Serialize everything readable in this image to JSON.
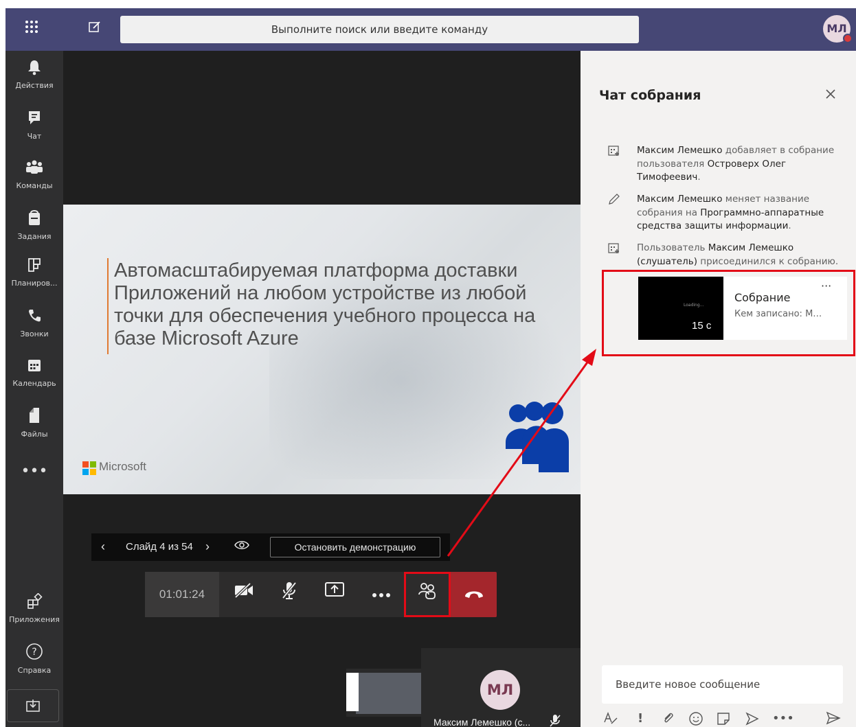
{
  "topbar": {
    "apps_icon": "grid-icon",
    "compose_icon": "compose-icon",
    "search_placeholder": "Выполните поиск или введите команду",
    "avatar_initials": "МЛ"
  },
  "rail": {
    "items": [
      {
        "label": "Действия",
        "icon": "bell-icon"
      },
      {
        "label": "Чат",
        "icon": "chat-icon"
      },
      {
        "label": "Команды",
        "icon": "teams-icon"
      },
      {
        "label": "Задания",
        "icon": "assignments-icon"
      },
      {
        "label": "Планиров...",
        "icon": "planner-icon"
      },
      {
        "label": "Звонки",
        "icon": "phone-icon"
      },
      {
        "label": "Календарь",
        "icon": "calendar-icon"
      },
      {
        "label": "Файлы",
        "icon": "files-icon"
      }
    ],
    "more": "•••",
    "bottom": [
      {
        "label": "Приложения",
        "icon": "apps-icon"
      },
      {
        "label": "Справка",
        "icon": "help-icon"
      }
    ],
    "download_icon": "download-icon"
  },
  "slide": {
    "title": "Автомасштабируемая платформа доставки Приложений на любом устройстве из любой точки для обеспечения учебного процесса на базе Microsoft Azure",
    "brand": "Microsoft",
    "colors": {
      "accent_bar": "#e07a32",
      "people_icon": "#0b3ea8"
    }
  },
  "slide_controls": {
    "prev": "‹",
    "counter": "Слайд 4 из 54",
    "next": "›",
    "stop_label": "Остановить демонстрацию"
  },
  "call_controls": {
    "timer": "01:01:24",
    "hangup_color": "#a4262c",
    "highlight_color": "#e30b17"
  },
  "self_view": {
    "initials": "МЛ",
    "name": "Максим Лемешко (с..."
  },
  "chat": {
    "title": "Чат собрания",
    "events": [
      {
        "icon": "add-person-icon",
        "actor": "Максим Лемешко",
        "text": " добавляет в собрание пользователя ",
        "target": "Островерх Олег Тимофеевич",
        "end": "."
      },
      {
        "icon": "pencil-icon",
        "actor": "Максим Лемешко",
        "text": " меняет название собрания на ",
        "target": "Программно-аппаратные средства защиты информации",
        "end": "."
      },
      {
        "icon": "add-person-icon",
        "actor": "Пользователь ",
        "text": "Максим Лемешко (слушатель)",
        "target": " присоединился к собранию.",
        "end": ""
      }
    ],
    "recording": {
      "loading_text": "Loading...",
      "duration": "15 с",
      "title": "Собрание",
      "subtitle": "Кем записано: Макс...",
      "more": "···"
    },
    "compose_placeholder": "Введите новое сообщение"
  }
}
